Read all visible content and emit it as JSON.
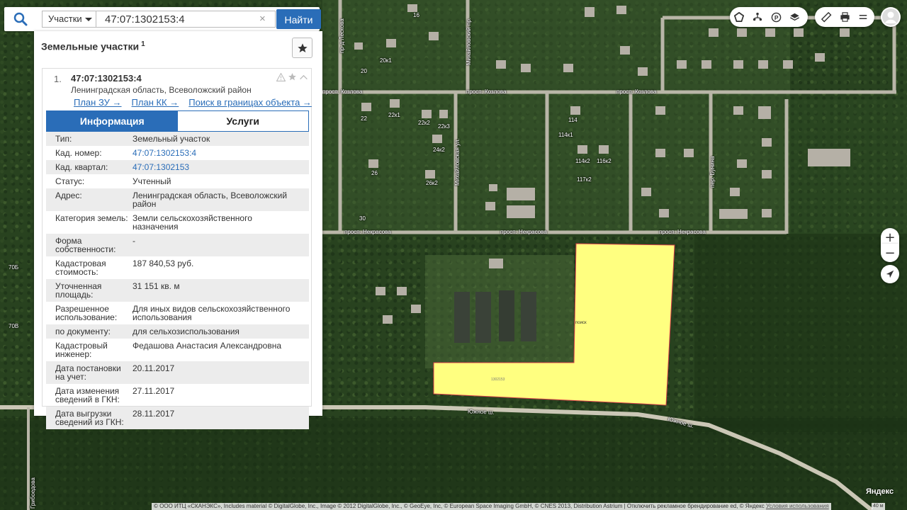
{
  "search": {
    "layer_select": "Участки",
    "query": "47:07:1302153:4",
    "clear_glyph": "×",
    "find_label": "Найти"
  },
  "panel": {
    "title": "Земельные участки",
    "count": "1",
    "card": {
      "index": "1.",
      "cad_number": "47:07:1302153:4",
      "region": "Ленинградская область, Всеволожский район",
      "links": [
        "План ЗУ →",
        "План КК →",
        "Поиск в границах объекта →"
      ]
    },
    "tabs": [
      "Информация",
      "Услуги"
    ],
    "fields": [
      {
        "k": "Тип:",
        "v": "Земельный участок"
      },
      {
        "k": "Кад. номер:",
        "v": "47:07:1302153:4",
        "link": true
      },
      {
        "k": "Кад. квартал:",
        "v": "47:07:1302153",
        "link": true
      },
      {
        "k": "Статус:",
        "v": "Учтенный"
      },
      {
        "k": "Адрес:",
        "v": "Ленинградская область, Всеволожский район"
      },
      {
        "k": "Категория земель:",
        "v": "Земли сельскохозяйственного назначения"
      },
      {
        "k": "Форма собственности:",
        "v": "-"
      },
      {
        "k": "Кадастровая стоимость:",
        "v": "187 840,53 руб."
      },
      {
        "k": "Уточненная площадь:",
        "v": "31 151 кв. м"
      },
      {
        "k": "Разрешенное использование:",
        "v": "Для иных видов сельскохозяйственного использования"
      },
      {
        "k": "по документу:",
        "v": "для сельхозиспользования"
      },
      {
        "k": "Кадастровый инженер:",
        "v": "Федашова Анастасия Александровна"
      },
      {
        "k": "Дата постановки на учет:",
        "v": "20.11.2017"
      },
      {
        "k": "Дата изменения сведений в ГКН:",
        "v": "27.11.2017"
      },
      {
        "k": "Дата выгрузки сведений из ГКН:",
        "v": "28.11.2017"
      }
    ]
  },
  "map": {
    "streets": [
      "просп. Козлова",
      "просп. Козлова",
      "просп. Козлова",
      "просп. Некрасова",
      "просп. Некрасова",
      "просп. Некрасова",
      "Южное ш.",
      "Южное ш.",
      "пр-д Лескова",
      "Михайловский пр.",
      "Михайловская ул.",
      "пер. Бунина",
      "Грибоедова"
    ],
    "numbers": [
      "16",
      "20",
      "20к1",
      "22",
      "22к1",
      "22к2",
      "22к3",
      "24к2",
      "26",
      "26к2",
      "30",
      "114",
      "114к1",
      "114к2",
      "116к2",
      "117к2",
      "70Б",
      "70В"
    ],
    "parcel_label": "поиск",
    "parcel_number": "1302153",
    "parcel_color": "#ffff80",
    "parcel_border": "#d9404a",
    "yandex": "Яндекс",
    "scale": "40 м",
    "copyright": "© ООО ИТЦ «СКАНЭКС», Includes material © DigitalGlobe, Inc., Image © 2012 DigitalGlobe, Inc., © GeoEye, Inc, © European Space Imaging GmbH, © CNES 2013, Distribution Astrium | Отключить рекламное брендирование ed, © Яндекс",
    "terms": "Условия использования"
  },
  "controls": {
    "group1": [
      "polygon-icon",
      "tree-icon",
      "parking-icon",
      "layers-icon"
    ],
    "group2": [
      "ruler-icon",
      "print-icon",
      "menu-icon"
    ],
    "zoom_in": "+",
    "zoom_out": "−"
  },
  "colors": {
    "accent": "#2a6db8"
  }
}
